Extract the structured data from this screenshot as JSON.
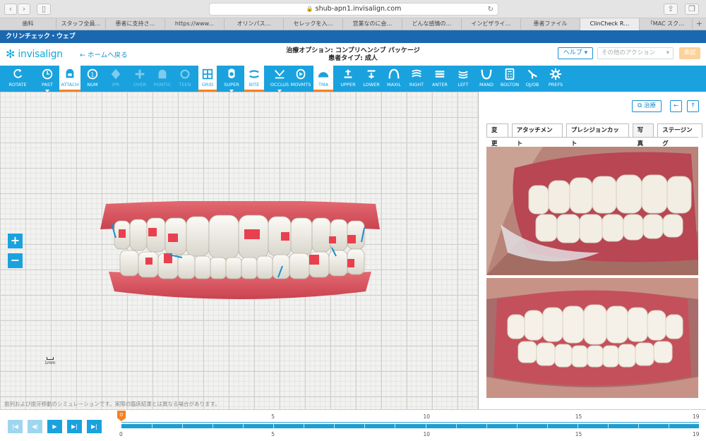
{
  "browser": {
    "url": "shub-apn1.invisalign.com",
    "tabs": [
      "歯科",
      "スタッフ全員…",
      "患者に支持さ…",
      "https://www...",
      "オリンパス…",
      "セレックを入…",
      "営業なのに会…",
      "どんな感情の…",
      "インビザライ…",
      "患者ファイル",
      "ClinCheck R…",
      "「MAC スク…"
    ],
    "active_tab_index": 10
  },
  "appbar": {
    "title": "クリンチェック・ウェブ"
  },
  "header": {
    "logo_text": "invisalign",
    "home_link": "ホームへ戻る",
    "treatment_option": "治療オプション: コンプリヘンシブ パッケージ",
    "patient_type": "患者タイプ: 成人",
    "help_label": "ヘルプ",
    "other_actions_label": "その他のアクション",
    "approve_label": "承認"
  },
  "toolbar": {
    "items": [
      {
        "label": "ROTATE",
        "icon": "rotate-icon",
        "state": "normal"
      },
      {
        "label": "PAST",
        "icon": "past-icon",
        "state": "normal"
      },
      {
        "label": "ATTACH",
        "icon": "attach-icon",
        "state": "selected"
      },
      {
        "label": "NUM",
        "icon": "num-icon",
        "state": "normal"
      },
      {
        "label": "IPR",
        "icon": "ipr-icon",
        "state": "disabled"
      },
      {
        "label": "OVER",
        "icon": "over-icon",
        "state": "disabled"
      },
      {
        "label": "PONTIC",
        "icon": "pontic-icon",
        "state": "disabled"
      },
      {
        "label": "TEEN",
        "icon": "teen-icon",
        "state": "disabled"
      },
      {
        "label": "GRID",
        "icon": "grid-icon",
        "state": "selected"
      },
      {
        "label": "SUPER",
        "icon": "super-icon",
        "state": "normal"
      },
      {
        "label": "BITE",
        "icon": "bite-icon",
        "state": "selected"
      },
      {
        "label": "OCCLUS",
        "icon": "occlus-icon",
        "state": "normal"
      },
      {
        "label": "MOVMTS",
        "icon": "movmts-icon",
        "state": "normal"
      },
      {
        "label": "TMA",
        "icon": "tma-icon",
        "state": "selected"
      },
      {
        "label": "UPPER",
        "icon": "upper-icon",
        "state": "normal"
      },
      {
        "label": "LOWER",
        "icon": "lower-icon",
        "state": "normal"
      },
      {
        "label": "MAXIL",
        "icon": "maxil-icon",
        "state": "normal"
      },
      {
        "label": "RIGHT",
        "icon": "right-icon",
        "state": "normal"
      },
      {
        "label": "ANTER",
        "icon": "anter-icon",
        "state": "normal"
      },
      {
        "label": "LEFT",
        "icon": "left-icon",
        "state": "normal"
      },
      {
        "label": "MAND",
        "icon": "mand-icon",
        "state": "normal"
      },
      {
        "label": "BOLTON",
        "icon": "bolton-icon",
        "state": "normal"
      },
      {
        "label": "OJ/OB",
        "icon": "ojob-icon",
        "state": "normal"
      },
      {
        "label": "PREFS",
        "icon": "prefs-icon",
        "state": "normal"
      }
    ]
  },
  "viewport": {
    "zoom_in": "+",
    "zoom_out": "−",
    "scale_label": "1mm",
    "disclaimer": "歯列および歯牙移動のシミュレーションです。実際の臨床結果とは異なる場合があります。"
  },
  "right_panel": {
    "treatment_button": "治療",
    "tabs": [
      "変更",
      "アタッチメント",
      "プレシジョンカット",
      "写真",
      "ステージング"
    ],
    "active_tab": "写真",
    "photos": [
      "right-buccal-photo",
      "frontal-photo"
    ]
  },
  "timeline": {
    "current_stage": "0",
    "max_stage": 19,
    "top_labels": [
      "5",
      "10",
      "15",
      "19"
    ],
    "bottom_labels": [
      "0",
      "5",
      "10",
      "15",
      "19"
    ]
  },
  "colors": {
    "accent": "#1aa2de",
    "selected_underline": "#f58220",
    "appbar": "#1a68b0"
  }
}
